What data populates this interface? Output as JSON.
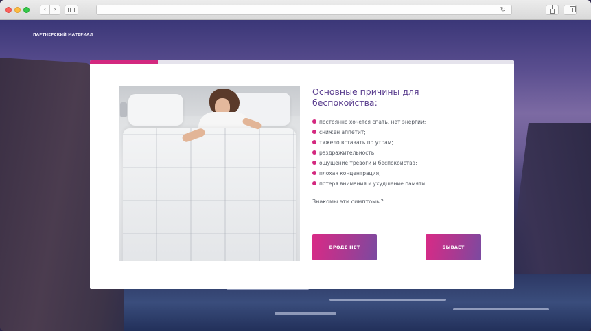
{
  "browser": {
    "back_icon": "‹",
    "forward_icon": "›",
    "reload_icon": "↻",
    "address_text": ""
  },
  "page": {
    "partner_label": "ПАРТНЕРСКИЙ МАТЕРИАЛ"
  },
  "quiz": {
    "progress": 0.16,
    "heading": "Основные причины для беспокойства:",
    "symptoms": [
      "постоянно хочется спать, нет энергии;",
      "снижен аппетит;",
      "тяжело вставать по утрам;",
      "раздражительность;",
      "ощущение тревоги и беспокойства;",
      "плохая концентрация;",
      "потеря внимания и ухудшение памяти."
    ],
    "question": "Знакомы эти симптомы?",
    "answers": {
      "no": "ВРОДЕ НЕТ",
      "yes": "БЫВАЕТ"
    }
  },
  "colors": {
    "accent": "#d3287f",
    "heading": "#5b3f8f",
    "button_gradient_start": "#d92a86",
    "button_gradient_end": "#7b4aa0"
  }
}
